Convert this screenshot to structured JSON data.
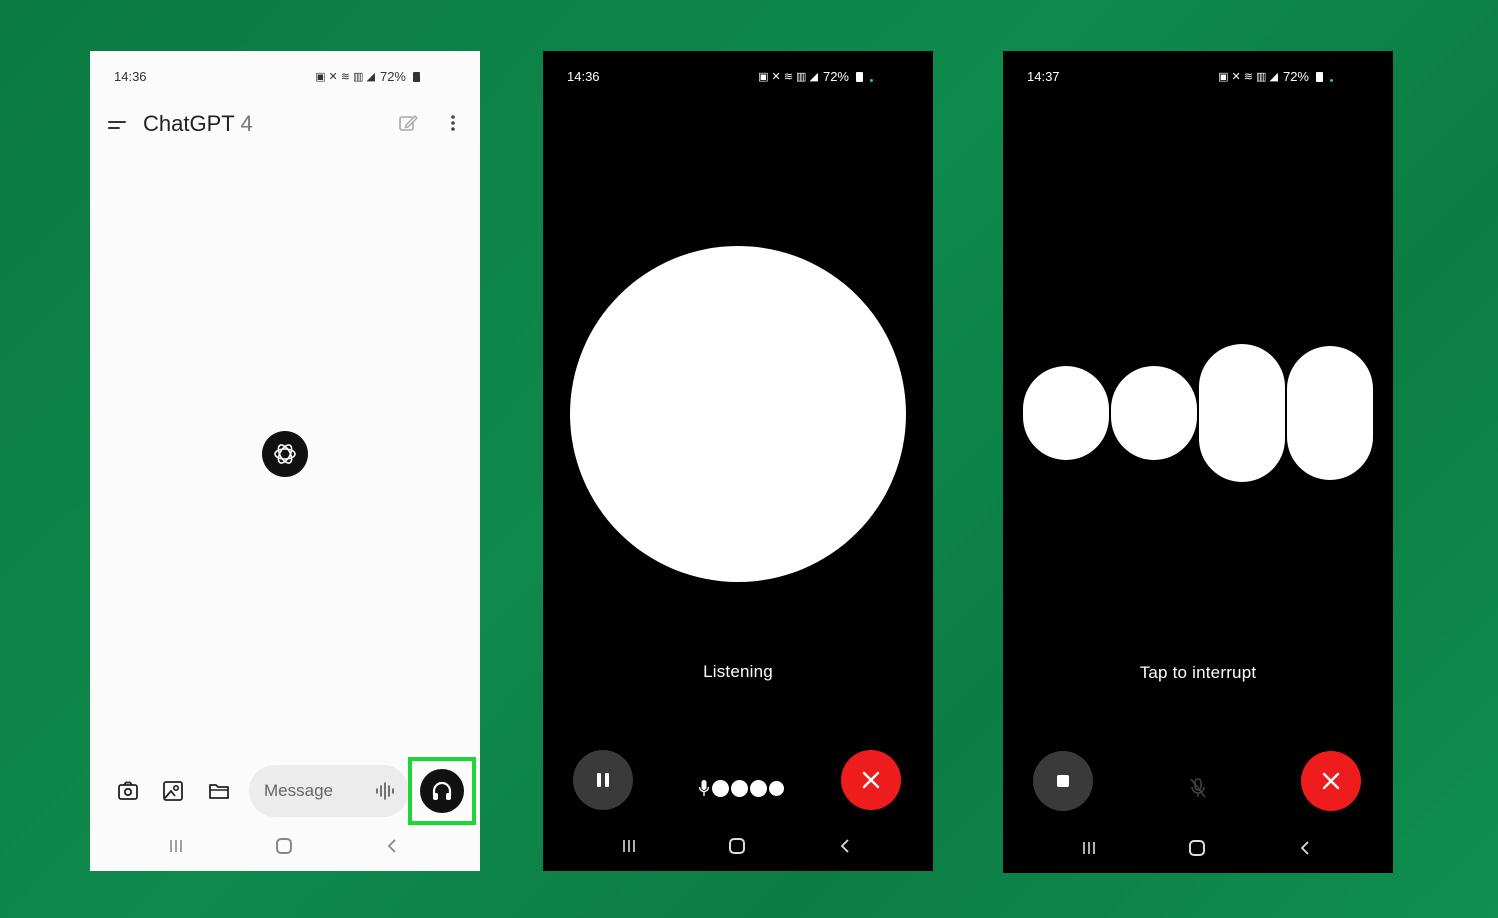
{
  "colors": {
    "background_green": "#0e8a4c",
    "highlight": "#1bd635",
    "end_call_red": "#ee1c1c",
    "control_grey": "#3a3a3a"
  },
  "screens": [
    {
      "status": {
        "time": "14:36",
        "battery": "72%"
      },
      "app": {
        "title": "ChatGPT",
        "version": "4"
      },
      "composer": {
        "placeholder": "Message"
      },
      "icons": [
        "menu-icon",
        "edit-icon",
        "more-icon",
        "openai-logo-icon",
        "camera-icon",
        "image-icon",
        "folder-icon",
        "waveform-icon",
        "headphones-icon"
      ]
    },
    {
      "status": {
        "time": "14:36",
        "battery": "72%"
      },
      "state_label": "Listening",
      "icons": [
        "pause-icon",
        "microphone-icon",
        "close-icon"
      ]
    },
    {
      "status": {
        "time": "14:37",
        "battery": "72%"
      },
      "state_label": "Tap to interrupt",
      "icons": [
        "stop-icon",
        "microphone-muted-icon",
        "close-icon"
      ]
    }
  ]
}
